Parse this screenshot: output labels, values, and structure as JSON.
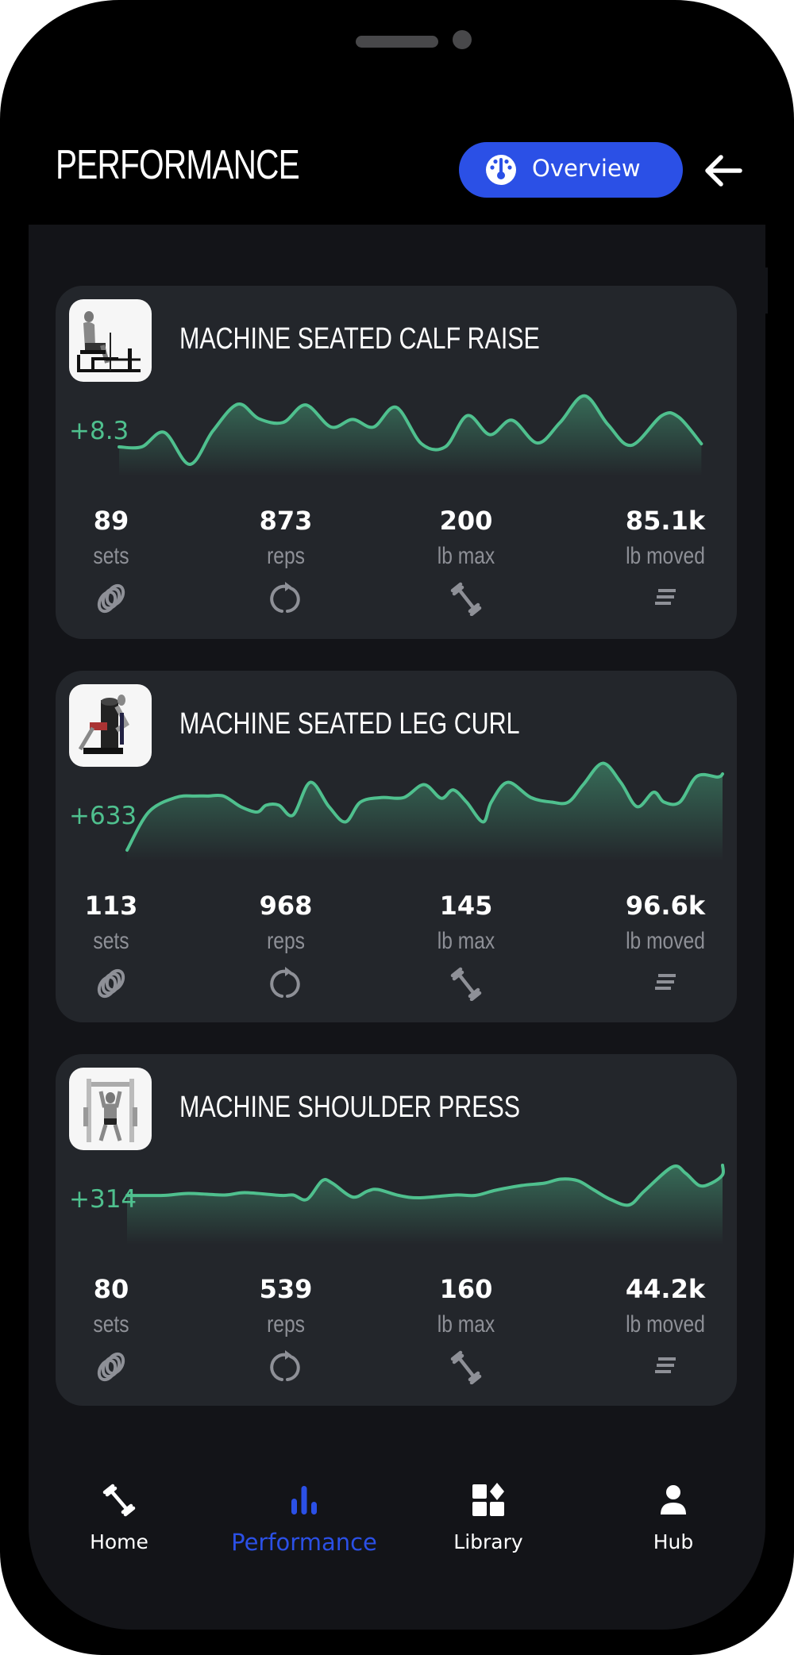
{
  "header": {
    "title": "PERFORMANCE",
    "overview_label": "Overview",
    "overview_icon": "gauge-icon",
    "back_icon": "arrow-left-icon"
  },
  "colors": {
    "accent": "#2b50e6",
    "positive": "#4fc08e",
    "card_bg": "#23262b",
    "screen_bg": "#131418",
    "muted": "#8e9097"
  },
  "cards": [
    {
      "title": "MACHINE SEATED CALF RAISE",
      "thumbnail": "seated-calf-raise-illustration",
      "delta": "+8.3",
      "stats": [
        {
          "value": "89",
          "unit": "sets",
          "icon": "rings-icon"
        },
        {
          "value": "873",
          "unit": "reps",
          "icon": "repeat-icon"
        },
        {
          "value": "200",
          "unit": "lb max",
          "icon": "dumbbell-icon"
        },
        {
          "value": "85.1k",
          "unit": "lb moved",
          "icon": "lines-icon"
        }
      ]
    },
    {
      "title": "MACHINE SEATED LEG CURL",
      "thumbnail": "seated-leg-curl-illustration",
      "delta": "+633",
      "stats": [
        {
          "value": "113",
          "unit": "sets",
          "icon": "rings-icon"
        },
        {
          "value": "968",
          "unit": "reps",
          "icon": "repeat-icon"
        },
        {
          "value": "145",
          "unit": "lb max",
          "icon": "dumbbell-icon"
        },
        {
          "value": "96.6k",
          "unit": "lb moved",
          "icon": "lines-icon"
        }
      ]
    },
    {
      "title": "MACHINE SHOULDER PRESS",
      "thumbnail": "shoulder-press-illustration",
      "delta": "+314",
      "stats": [
        {
          "value": "80",
          "unit": "sets",
          "icon": "rings-icon"
        },
        {
          "value": "539",
          "unit": "reps",
          "icon": "repeat-icon"
        },
        {
          "value": "160",
          "unit": "lb max",
          "icon": "dumbbell-icon"
        },
        {
          "value": "44.2k",
          "unit": "lb moved",
          "icon": "lines-icon"
        }
      ]
    }
  ],
  "chart_data": [
    {
      "type": "area",
      "title": "MACHINE SEATED CALF RAISE trend",
      "annotation": "+8.3",
      "xlabel": "",
      "ylabel": "",
      "grid": false,
      "ylim": [
        0,
        100
      ],
      "x": [
        0,
        4,
        8,
        12.5,
        16.6,
        21,
        24.7,
        29,
        33,
        37.5,
        41.3,
        45,
        49,
        53.5,
        57.7,
        61.6,
        65.6,
        69.5,
        74,
        78,
        82.3,
        86.5,
        90.6,
        96,
        99,
        103
      ],
      "values": [
        24,
        24,
        43,
        1,
        45,
        80,
        61,
        56,
        79,
        50,
        60,
        50,
        76,
        28,
        24,
        65,
        40,
        59,
        29,
        56,
        91,
        53,
        26,
        65,
        63,
        28
      ]
    },
    {
      "type": "area",
      "title": "MACHINE SEATED LEG CURL trend",
      "annotation": "+633",
      "xlabel": "",
      "ylabel": "",
      "grid": false,
      "ylim": [
        0,
        100
      ],
      "x": [
        0,
        2.9,
        6.5,
        9.1,
        10.8,
        12.9,
        15.2,
        17.4,
        18.6,
        20.3,
        22.2,
        24.5,
        27,
        29.2,
        31.2,
        34,
        37,
        39.7,
        42,
        43.6,
        45.4,
        47.6,
        48.7,
        50.9,
        54,
        56.8,
        59,
        61,
        63.6,
        66,
        68.2,
        70.4,
        71.8,
        73.9,
        76.2,
        79,
        81.5
      ],
      "values": [
        0,
        50,
        69,
        71,
        71,
        71,
        57,
        50,
        59,
        59,
        46,
        89,
        57,
        37,
        63,
        69,
        69,
        86,
        68,
        79,
        63,
        37,
        63,
        89,
        69,
        63,
        63,
        86,
        114,
        89,
        57,
        76,
        63,
        63,
        97,
        96,
        100
      ]
    },
    {
      "type": "area",
      "title": "MACHINE SHOULDER PRESS trend",
      "annotation": "+314",
      "xlabel": "",
      "ylabel": "",
      "grid": false,
      "ylim": [
        0,
        100
      ],
      "x": [
        0,
        5,
        8.5,
        13.5,
        16.3,
        21.3,
        23,
        24.9,
        27,
        28.4,
        31.2,
        33.3,
        34.7,
        37.6,
        40.4,
        45.4,
        48.2,
        51,
        54.6,
        57.8,
        60,
        62.4,
        64.5,
        66.9,
        69.5,
        71.6,
        75.5,
        77.3,
        79.2,
        80.9,
        83,
        84.4
      ],
      "values": [
        24,
        24,
        29,
        25,
        31,
        24,
        25,
        14,
        61,
        55,
        20,
        35,
        39,
        24,
        18,
        25,
        24,
        37,
        49,
        55,
        65,
        61,
        39,
        14,
        0,
        35,
        96,
        80,
        49,
        55,
        76,
        100
      ]
    }
  ],
  "navbar": {
    "items": [
      {
        "label": "Home",
        "icon": "dumbbell-icon",
        "active": false
      },
      {
        "label": "Performance",
        "icon": "bar-chart-icon",
        "active": true
      },
      {
        "label": "Library",
        "icon": "library-icon",
        "active": false
      },
      {
        "label": "Hub",
        "icon": "person-icon",
        "active": false
      }
    ]
  }
}
